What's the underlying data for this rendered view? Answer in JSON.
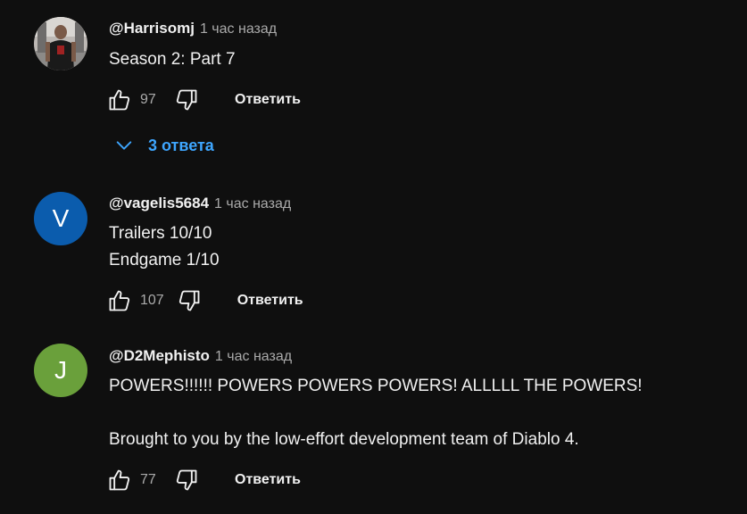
{
  "colors": {
    "background": "#0f0f0f",
    "text_primary": "#f1f1f1",
    "text_secondary": "#aaaaaa",
    "link_blue": "#3ea6ff",
    "avatar_v": "#0b5cad",
    "avatar_j": "#6aa03b"
  },
  "comments": [
    {
      "author": "@Harrisomj",
      "time": "1 час назад",
      "text": "Season 2: Part 7",
      "likes": "97",
      "reply_label": "Ответить",
      "avatar_type": "photo",
      "replies_toggle": "3 ответа"
    },
    {
      "author": "@vagelis5684",
      "time": "1 час назад",
      "text": "Trailers 10/10\nEndgame 1/10",
      "likes": "107",
      "reply_label": "Ответить",
      "avatar_letter": "V"
    },
    {
      "author": "@D2Mephisto",
      "time": "1 час назад",
      "text": "POWERS!!!!!! POWERS POWERS POWERS! ALLLLL THE POWERS!\n\nBrought to you by the low-effort development team of Diablo 4.",
      "likes": "77",
      "reply_label": "Ответить",
      "avatar_letter": "J"
    }
  ],
  "icons": {
    "like": "thumbs-up-icon",
    "dislike": "thumbs-down-icon",
    "expand": "chevron-down-icon"
  }
}
